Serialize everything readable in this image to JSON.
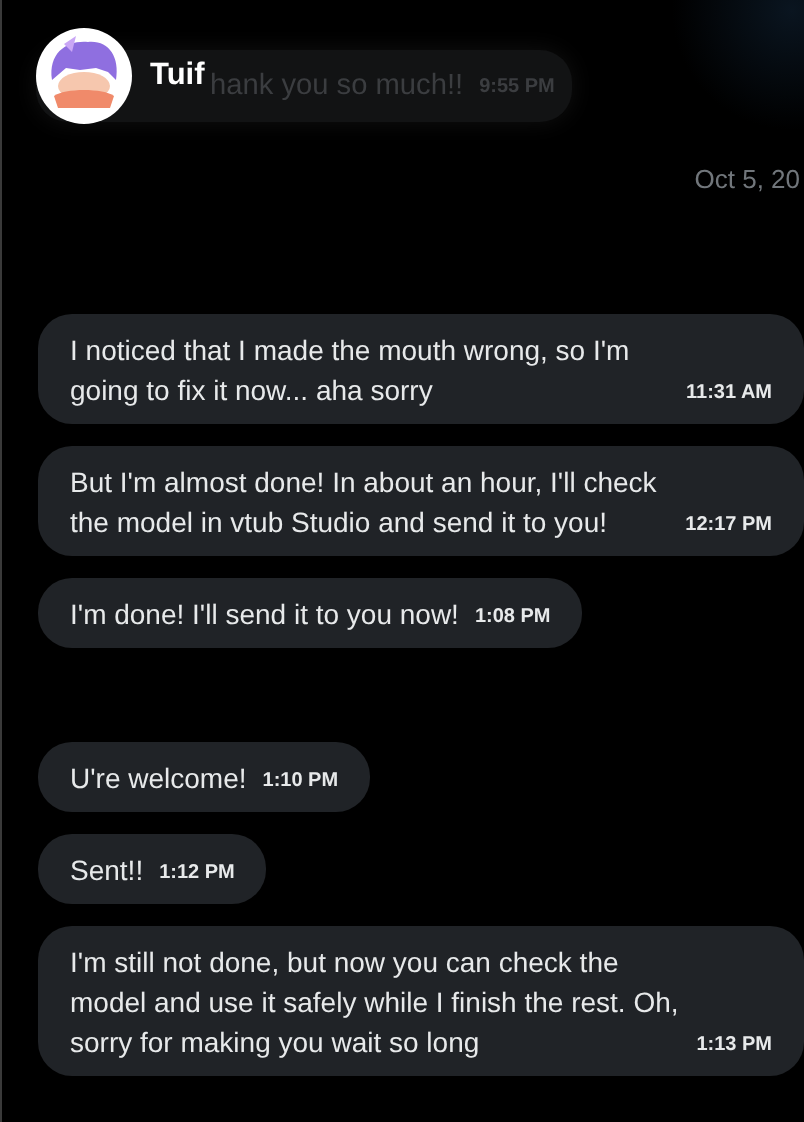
{
  "header": {
    "name": "Tuif"
  },
  "faded_message": {
    "text": "hank you so much!!",
    "time": "9:55 PM"
  },
  "date_separator": "Oct 5, 20",
  "message_groups": [
    {
      "messages": [
        {
          "text": "I noticed that I made the mouth wrong, so I'm going to fix it now... aha sorry",
          "time": "11:31 AM"
        },
        {
          "text": "But I'm almost done! In about an hour, I'll check the model in vtub Studio and send it to you!",
          "time": "12:17 PM"
        },
        {
          "text": "I'm done! I'll send it to you now!",
          "time": "1:08 PM"
        }
      ]
    },
    {
      "messages": [
        {
          "text": "U're welcome!",
          "time": "1:10 PM"
        },
        {
          "text": "Sent!!",
          "time": "1:12 PM"
        },
        {
          "text": "I'm still not done, but now you can check the model and use it safely while I finish the rest. Oh, sorry for making you wait so long",
          "time": "1:13 PM"
        }
      ]
    }
  ]
}
